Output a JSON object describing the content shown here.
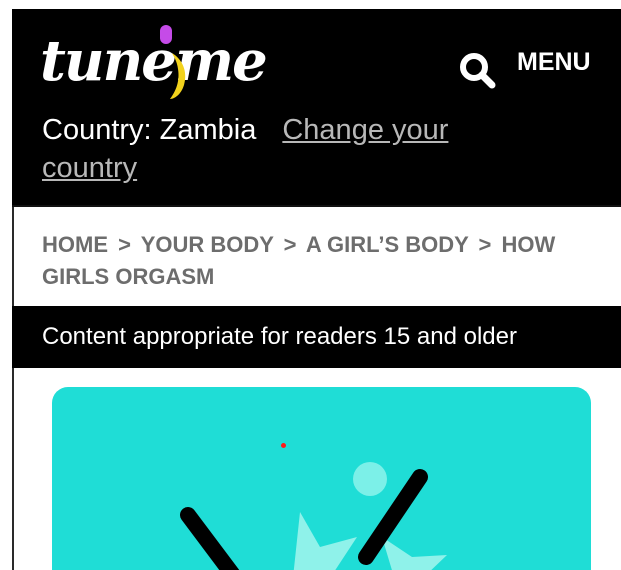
{
  "header": {
    "logo_text": "tuneme",
    "search_icon": "search-icon",
    "menu_label": "MENU",
    "country_label": "Country: Zambia",
    "change_country_label": "Change your country"
  },
  "breadcrumb": {
    "items": [
      "HOME",
      "YOUR BODY",
      "A GIRL’S BODY",
      "HOW GIRLS ORGASM"
    ],
    "separator": ">"
  },
  "banner": {
    "age_notice": "Content appropriate for readers 15 and older"
  },
  "colors": {
    "header_bg": "#000000",
    "hero_bg": "#1fddd6",
    "logo_dot": "#c54be8",
    "logo_swoosh": "#f2d21c",
    "breadcrumb_text": "#6d6d6d",
    "link_muted": "#b8b8b8"
  }
}
